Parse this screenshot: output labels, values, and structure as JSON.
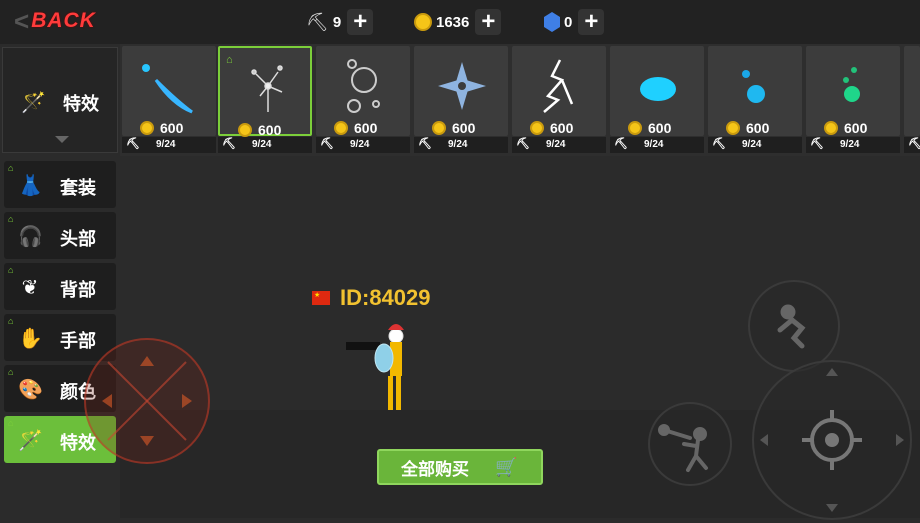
{
  "topbar": {
    "back_label": "BACK",
    "pickaxes": "9",
    "coins": "1636",
    "gems": "0"
  },
  "sidebar": {
    "header_label": "特效",
    "items": [
      {
        "label": "套装",
        "icon": "outfit-icon"
      },
      {
        "label": "头部",
        "icon": "headphones-icon"
      },
      {
        "label": "背部",
        "icon": "back-icon"
      },
      {
        "label": "手部",
        "icon": "hand-icon"
      },
      {
        "label": "颜色",
        "icon": "palette-icon"
      },
      {
        "label": "特效",
        "icon": "magic-wand-icon",
        "active": true
      }
    ]
  },
  "shop_items": [
    {
      "price": "600",
      "progress": "9/24",
      "effect": "blue-feather"
    },
    {
      "price": "600",
      "progress": "9/24",
      "effect": "dandelion",
      "selected": true
    },
    {
      "price": "600",
      "progress": "9/24",
      "effect": "bubbles"
    },
    {
      "price": "600",
      "progress": "9/24",
      "effect": "shuriken"
    },
    {
      "price": "600",
      "progress": "9/24",
      "effect": "lightning"
    },
    {
      "price": "600",
      "progress": "9/24",
      "effect": "cyan-blob"
    },
    {
      "price": "600",
      "progress": "9/24",
      "effect": "blue-orbs"
    },
    {
      "price": "600",
      "progress": "9/24",
      "effect": "green-orbs"
    }
  ],
  "player": {
    "id_text": "ID:84029"
  },
  "buy_all_label": "全部购买",
  "colors": {
    "accent_green": "#6cbf3b",
    "back_red": "#ff3b3b",
    "id_gold": "#f2c230"
  }
}
